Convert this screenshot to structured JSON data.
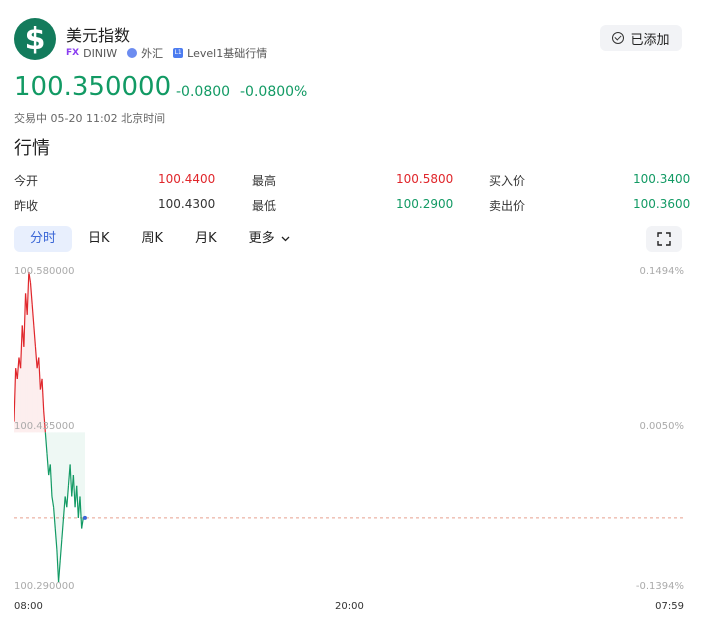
{
  "header": {
    "logo_symbol": "$",
    "name": "美元指数",
    "tags": [
      {
        "icon": "fx-badge",
        "label": "DINIW",
        "badge": "FX"
      },
      {
        "icon": "globe-icon",
        "label": "外汇"
      },
      {
        "icon": "level1-icon",
        "label": "Level1基础行情",
        "badge": "L1"
      }
    ],
    "added_label": "已添加"
  },
  "quote": {
    "price": "100.350000",
    "change": "-0.0800",
    "change_pct": "-0.0800%",
    "status": "交易中 05-20 11:02 北京时间"
  },
  "section_title": "行情",
  "stats": {
    "open_label": "今开",
    "open": "100.4400",
    "high_label": "最高",
    "high": "100.5800",
    "bid_label": "买入价",
    "bid": "100.3400",
    "prev_label": "昨收",
    "prev": "100.4300",
    "low_label": "最低",
    "low": "100.2900",
    "ask_label": "卖出价",
    "ask": "100.3600"
  },
  "tabs": [
    {
      "label": "分时",
      "active": true
    },
    {
      "label": "日K",
      "active": false
    },
    {
      "label": "周K",
      "active": false
    },
    {
      "label": "月K",
      "active": false
    },
    {
      "label": "更多",
      "active": false,
      "dropdown": true
    }
  ],
  "colors": {
    "up": "#e0262b",
    "down": "#129a64",
    "accent": "#3a66d6"
  },
  "chart_data": {
    "type": "line",
    "title": "",
    "y_labels": {
      "top": "100.580000",
      "mid": "100.435000",
      "bottom": "100.290000"
    },
    "pct_labels": {
      "top": "0.1494%",
      "mid": "0.0050%",
      "bottom": "-0.1394%"
    },
    "x_ticks": [
      "08:00",
      "20:00",
      "07:59"
    ],
    "ylim": [
      100.29,
      100.58
    ],
    "reference_value": 100.43,
    "current_value": 100.35,
    "series": [
      {
        "values": [
          100.44,
          100.49,
          100.48,
          100.5,
          100.49,
          100.53,
          100.51,
          100.56,
          100.54,
          100.58,
          100.57,
          100.55,
          100.53,
          100.51,
          100.49,
          100.5,
          100.47,
          100.48,
          100.45,
          100.43,
          100.41,
          100.39,
          100.4,
          100.37,
          100.36,
          100.34,
          100.32,
          100.29,
          100.31,
          100.33,
          100.35,
          100.37,
          100.36,
          100.38,
          100.4,
          100.37,
          100.39,
          100.36,
          100.38,
          100.35,
          100.37,
          100.34,
          100.35,
          100.35
        ]
      }
    ]
  }
}
